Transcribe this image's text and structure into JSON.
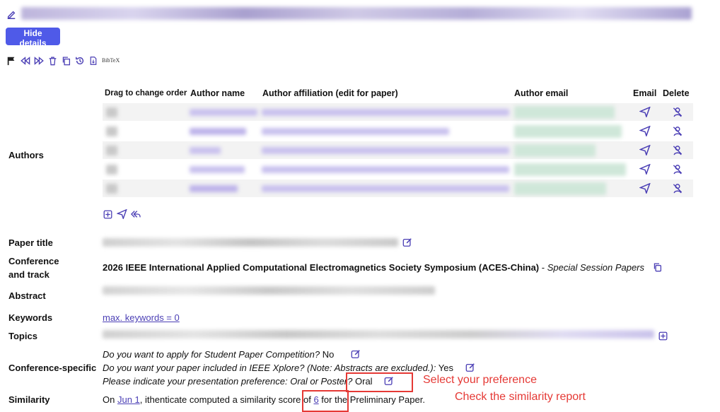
{
  "toolbar": {
    "hide_details_label": "Hide details",
    "bibtex_label": "BibTeX"
  },
  "authors_table": {
    "section_label": "Authors",
    "headers": {
      "order": "Drag to change order",
      "name": "Author name",
      "affiliation": "Author affiliation (edit for paper)",
      "email": "Author email",
      "email_action": "Email",
      "delete_action": "Delete"
    }
  },
  "fields": {
    "paper_title_label": "Paper title",
    "conference_label_1": "Conference",
    "conference_label_2": "and track",
    "conference_value": "2026 IEEE International Applied Computational Electromagnetics Society Symposium (ACES-China)",
    "conference_sep": " - ",
    "track_value": "Special Session Papers",
    "abstract_label": "Abstract",
    "keywords_label": "Keywords",
    "keywords_value": "max. keywords = 0",
    "topics_label": "Topics",
    "conference_specific_label": "Conference-specific",
    "q1": "Do you want to apply for Student Paper Competition?",
    "a1": "No",
    "q2": "Do you want your paper included in IEEE Xplore? (Note: Abstracts are excluded.):",
    "a2": "Yes",
    "q3": "Please indicate your presentation preference: Oral or Poster?",
    "a3": "Oral",
    "similarity_label": "Similarity",
    "sim_prefix": "On ",
    "sim_date": "Jun 1",
    "sim_middle": ", ithenticate computed a similarity score of ",
    "sim_score": "6",
    "sim_suffix": " for the Preliminary Paper."
  },
  "annotations": {
    "preference_note": "Select your preference",
    "similarity_note": "Check the similarity report"
  },
  "colors": {
    "accent": "#4b3fb5",
    "button": "#4f5ae8",
    "annotation": "#e53935"
  }
}
